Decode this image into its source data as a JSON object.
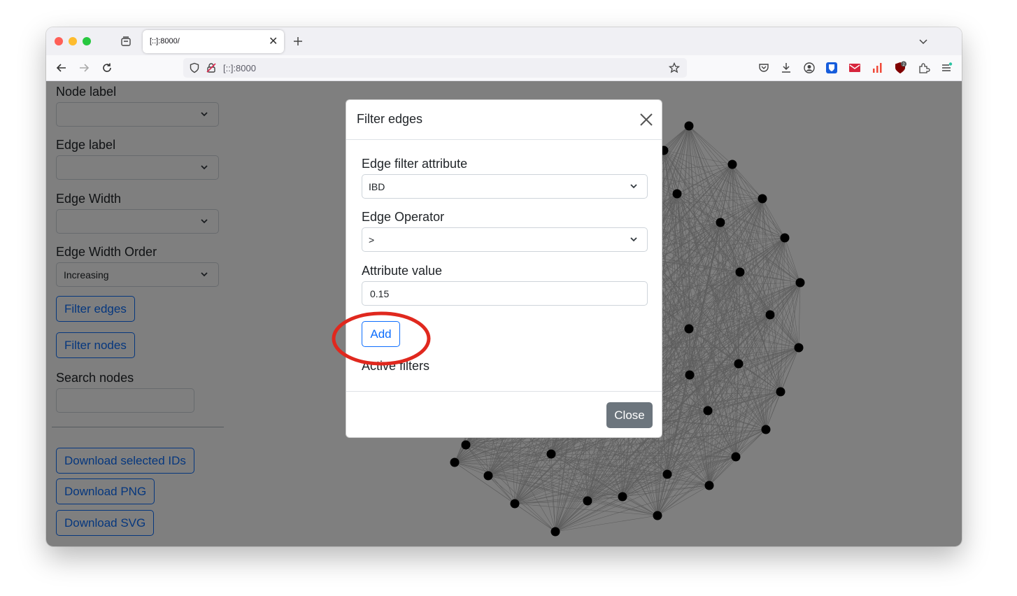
{
  "browser": {
    "tab_title": "[::]:8000/",
    "url": "[::]:8000",
    "notification_badge": "2"
  },
  "sidebar": {
    "node_label": "Node label",
    "node_label_value": "",
    "edge_label": "Edge label",
    "edge_label_value": "",
    "edge_width": "Edge Width",
    "edge_width_value": "",
    "edge_width_order": "Edge Width Order",
    "edge_width_order_value": "Increasing",
    "filter_edges_btn": "Filter edges",
    "filter_nodes_btn": "Filter nodes",
    "search_nodes": "Search nodes",
    "search_value": "",
    "download_ids_btn": "Download selected IDs",
    "download_png_btn": "Download PNG",
    "download_svg_btn": "Download SVG"
  },
  "modal": {
    "title": "Filter edges",
    "edge_filter_attribute_label": "Edge filter attribute",
    "edge_filter_attribute_value": "IBD",
    "edge_operator_label": "Edge Operator",
    "edge_operator_value": ">",
    "attribute_value_label": "Attribute value",
    "attribute_value": "0.15",
    "add_btn": "Add",
    "active_filters_label": "Active filters",
    "close_btn": "Close"
  },
  "annotation": {
    "highlight_color": "#e0281e"
  },
  "colors": {
    "primary": "#0d6efd",
    "secondary": "#6c757d",
    "backdrop": "rgba(0,0,0,0.5)"
  }
}
